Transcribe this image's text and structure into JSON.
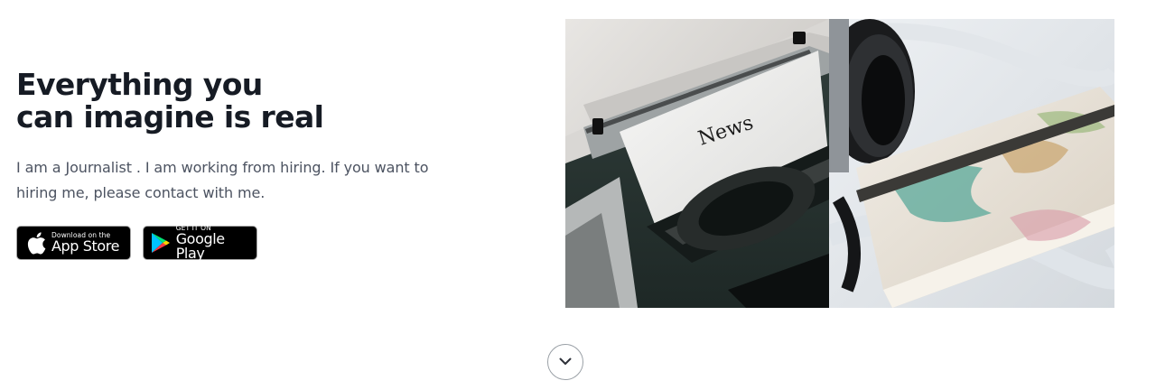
{
  "hero": {
    "headline_line1": "Everything you",
    "headline_line2": "can imagine is real",
    "description": "I am a Journalist . I am working from hiring. If you want to hiring me, please contact with me."
  },
  "store_badges": {
    "app_store": {
      "small": "Download on the",
      "big": "App Store",
      "icon": "apple-icon"
    },
    "google_play": {
      "small": "GET IT ON",
      "big": "Google Play",
      "icon": "google-play-icon"
    }
  },
  "gallery": {
    "typewriter_paper_text": "News"
  },
  "scroll_indicator": {
    "icon": "chevron-down-icon"
  },
  "colors": {
    "heading": "#161b24",
    "body_text": "#4c5361",
    "badge_bg": "#000000"
  }
}
